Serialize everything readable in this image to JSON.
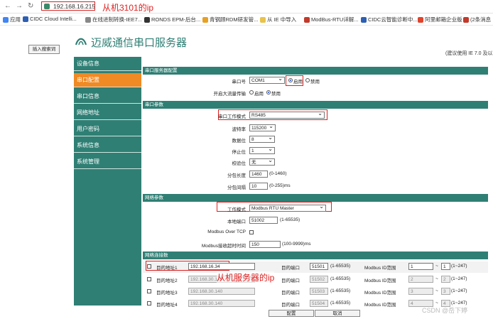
{
  "browser": {
    "address": "192.168.16.215",
    "annotation_top": "从机3101的ip",
    "bookmarks": [
      {
        "label": "应用",
        "color": "#4285f4"
      },
      {
        "label": "CIDC Cloud Intelli...",
        "color": "#2d5fb3"
      },
      {
        "label": "在线进制转换-IEE7...",
        "color": "#888888"
      },
      {
        "label": "RONDS EPM-后台...",
        "color": "#333333"
      },
      {
        "label": "青钢顾RDM研发管...",
        "color": "#e6a023"
      },
      {
        "label": "从 IE 中导入",
        "color": "#e8c24a"
      },
      {
        "label": "ModBus-RTU详解...",
        "color": "#c23a2b"
      },
      {
        "label": "CIDC云智能诊断中...",
        "color": "#2d5fb3"
      },
      {
        "label": "阿里邮箱企业版",
        "color": "#e0442c"
      },
      {
        "label": "(2条消息",
        "color": "#c23a2b"
      }
    ]
  },
  "page": {
    "search_button": "插入搜索词",
    "site_title": "迈威通信串口服务器",
    "ie_note": "(建议使用 IE 7.0 及以",
    "brand_color": "#2f7f74",
    "active_color": "#f08a24"
  },
  "sidebar": {
    "items": [
      "设备信息",
      "串口配置",
      "串口信息",
      "网络地址",
      "用户密码",
      "系统信息",
      "系统管理"
    ],
    "active_index": 1
  },
  "serial_config": {
    "section_title": "串口服务器配置",
    "port_label": "串口号",
    "port_value": "COM1",
    "enable_label": "启用",
    "disable_label": "禁用",
    "flow_label": "开启大流量传输",
    "flow_on": "启用",
    "flow_off": "禁用"
  },
  "serial_params": {
    "section_title": "串口参数",
    "mode_label": "串口工作模式",
    "mode_value": "RS485",
    "baud_label": "波特率",
    "baud_value": "115200",
    "databits_label": "数据位",
    "databits_value": "8",
    "stopbits_label": "停止位",
    "stopbits_value": "1",
    "parity_label": "校验位",
    "parity_value": "无",
    "pktlen_label": "分包长度",
    "pktlen_value": "1460",
    "pktlen_hint": "(0-1460)",
    "pktgap_label": "分包间隔",
    "pktgap_value": "10",
    "pktgap_hint": "(0-255)ms"
  },
  "network_params": {
    "section_title": "网络参数",
    "workmode_label": "工作模式",
    "workmode_value": "Modbus RTU Master",
    "localport_label": "本地端口",
    "localport_value": "51002",
    "localport_hint": "(1-65535)",
    "tcp_label": "Modbus Over TCP",
    "timeout_label": "Modbus接收超时时间",
    "timeout_value": "150",
    "timeout_hint": "(100-9999)ms"
  },
  "connections": {
    "section_title": "网络连接数",
    "dest_port_label": "目的端口",
    "port_hint": "(1-65535)",
    "id_label": "Modbus ID范围",
    "id_hint": "(1~247)",
    "tilde": "~",
    "rows": [
      {
        "label": "目的地址1",
        "ip": "192.168.16.34",
        "port": "51501",
        "id_from": "1",
        "id_to": "1"
      },
      {
        "label": "目的地址2",
        "ip": "192.168.30.140",
        "port": "51502",
        "id_from": "2",
        "id_to": "2"
      },
      {
        "label": "目的地址3",
        "ip": "192.168.30.140",
        "port": "51503",
        "id_from": "3",
        "id_to": "3"
      },
      {
        "label": "目的地址4",
        "ip": "192.168.30.140",
        "port": "51504",
        "id_from": "4",
        "id_to": "4"
      }
    ],
    "annotation": "从机服务器的ip"
  },
  "actions": {
    "save": "配置",
    "cancel": "取消"
  },
  "watermark": "CSDN @岳下婷"
}
